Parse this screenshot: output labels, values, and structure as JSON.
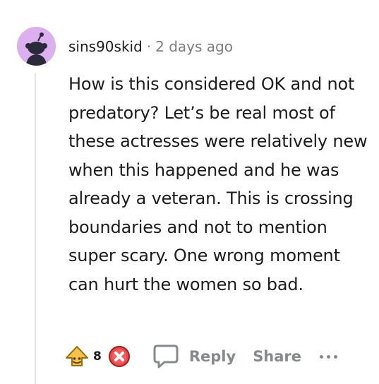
{
  "comment": {
    "username": "sins90skid",
    "separator": "·",
    "timestamp": "2 days ago",
    "body": "How is this considered OK and not predatory? Let’s be real most of these actresses were relatively new when this happened and he was already a veteran. This is crossing boundaries and not to mention super scary. One wrong moment can hurt the women so bad.",
    "avatar_color": "#dcb0ef"
  },
  "actions": {
    "upvote_icon": "upvote-emoji-icon",
    "vote_count": "8",
    "downvote_icon": "downvote-x-icon",
    "reply_icon": "comment-bubble-icon",
    "reply_label": "Reply",
    "share_label": "Share",
    "more_icon": "more-options-icon"
  }
}
